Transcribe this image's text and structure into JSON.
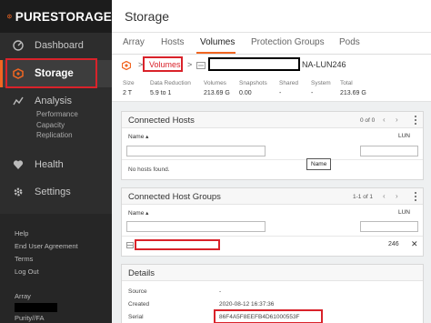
{
  "app": {
    "logo_text": "PURESTORAGE",
    "accent_color": "#f16622",
    "annotation_color": "#d9222a"
  },
  "sidebar": {
    "items": [
      {
        "label": "Dashboard",
        "icon": "dashboard-icon"
      },
      {
        "label": "Storage",
        "icon": "storage-icon",
        "active": true
      },
      {
        "label": "Analysis",
        "icon": "analysis-icon"
      },
      {
        "label": "Health",
        "icon": "health-icon"
      },
      {
        "label": "Settings",
        "icon": "settings-icon"
      }
    ],
    "analysis_sub": [
      "Performance",
      "Capacity",
      "Replication"
    ],
    "bottom_links": [
      "Help",
      "End User Agreement",
      "Terms",
      "Log Out"
    ],
    "array_label": "Array",
    "purity_label": "Purity//FA"
  },
  "header": {
    "title": "Storage"
  },
  "tabs": [
    "Array",
    "Hosts",
    "Volumes",
    "Protection Groups",
    "Pods"
  ],
  "breadcrumb": {
    "sep1": ">",
    "volumes": "Volumes",
    "sep2": ">",
    "volume_name_suffix": "NA-LUN246"
  },
  "stats": [
    {
      "label": "Size",
      "value": "2 T"
    },
    {
      "label": "Data Reduction",
      "value": "5.9 to 1"
    },
    {
      "label": "Volumes",
      "value": "213.69 G"
    },
    {
      "label": "Snapshots",
      "value": "0.00"
    },
    {
      "label": "Shared",
      "value": "-"
    },
    {
      "label": "System",
      "value": "-"
    },
    {
      "label": "Total",
      "value": "213.69 G"
    }
  ],
  "connected_hosts": {
    "title": "Connected Hosts",
    "pager": "0 of 0",
    "col_name": "Name",
    "col_lun": "LUN",
    "empty": "No hosts found.",
    "tooltip": "Name"
  },
  "connected_host_groups": {
    "title": "Connected Host Groups",
    "pager": "1-1 of 1",
    "col_name": "Name",
    "col_lun": "LUN",
    "row_lun": "246",
    "remove": "✕"
  },
  "details": {
    "title": "Details",
    "rows": [
      {
        "label": "Source",
        "value": "-"
      },
      {
        "label": "Created",
        "value": "2020-08-12 16:37:36"
      },
      {
        "label": "Serial",
        "value": "86F4A5F8EEFB4D61000553F"
      }
    ]
  }
}
